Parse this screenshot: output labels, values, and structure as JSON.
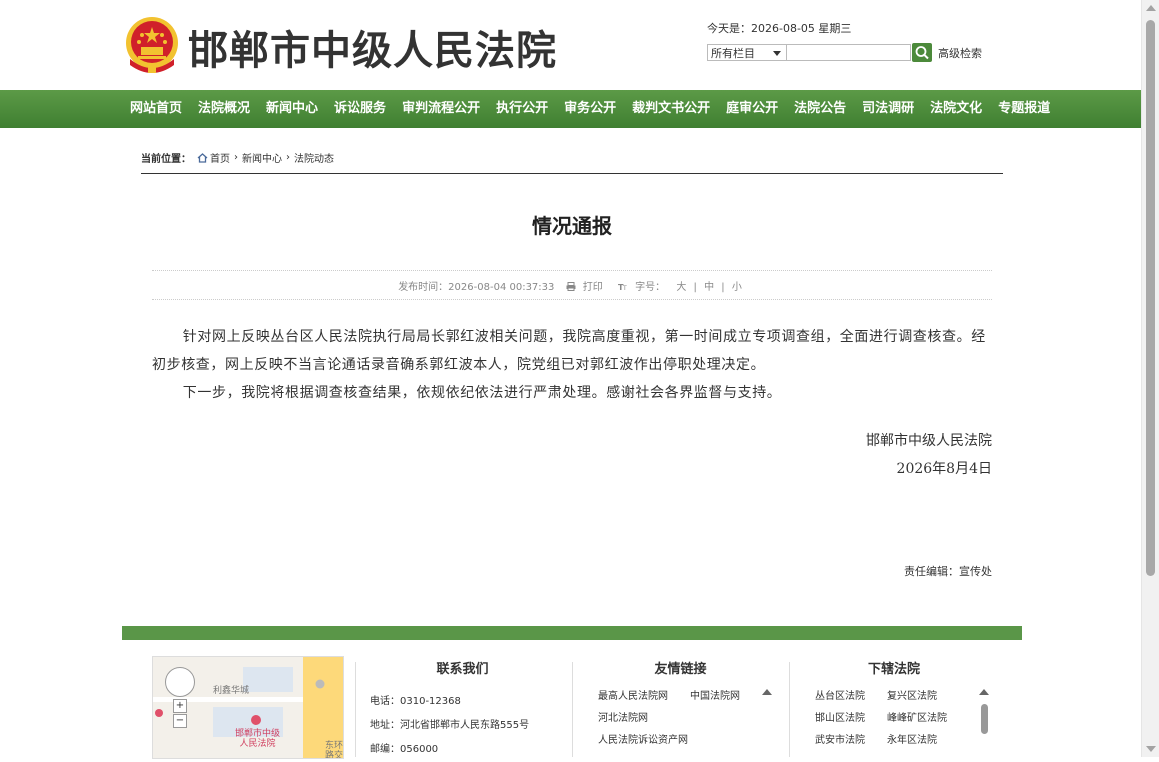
{
  "header": {
    "site_title": "邯郸市中级人民法院",
    "today": "今天是：2026-08-05 星期三",
    "search_scope": "所有栏目",
    "search_placeholder": "",
    "advanced_search": "高级检索"
  },
  "nav": {
    "items": [
      "网站首页",
      "法院概况",
      "新闻中心",
      "诉讼服务",
      "审判流程公开",
      "执行公开",
      "审务公开",
      "裁判文书公开",
      "庭审公开",
      "法院公告",
      "司法调研",
      "法院文化",
      "专题报道"
    ]
  },
  "breadcrumb": {
    "label": "当前位置：",
    "items": [
      "首页",
      "新闻中心",
      "法院动态"
    ],
    "separator": "›"
  },
  "article": {
    "title": "情况通报",
    "publish_time": "发布时间：2026-08-04 00:37:33",
    "print": "打印",
    "font_size_label": "字号：",
    "font_large": "大",
    "font_medium": "中",
    "font_small": "小",
    "paragraph1": "针对网上反映丛台区人民法院执行局局长郭红波相关问题，我院高度重视，第一时间成立专项调查组，全面进行调查核查。经初步核查，网上反映不当言论通话录音确系郭红波本人，院党组已对郭红波作出停职处理决定。",
    "paragraph2": "下一步，我院将根据调查核查结果，依规依纪依法进行严肃处理。感谢社会各界监督与支持。",
    "signature_org": "邯郸市中级人民法院",
    "signature_date": "2026年8月4日",
    "editor": "责任编辑：宣传处"
  },
  "footer": {
    "map": {
      "area_label": "利鑫华城",
      "place_label_1": "邯郸市中级",
      "place_label_2": "人民法院",
      "edge_label_1": "东环",
      "edge_label_2": "路交"
    },
    "contact": {
      "title": "联系我们",
      "phone": "电话：0310-12368",
      "address": "地址：河北省邯郸市人民东路555号",
      "postcode": "邮编：056000"
    },
    "friend_links": {
      "title": "友情链接",
      "row1a": "最高人民法院网",
      "row1b": "中国法院网",
      "row2a": "河北法院网",
      "row3a": "人民法院诉讼资产网"
    },
    "courts": {
      "title": "下辖法院",
      "row1a": "丛台区法院",
      "row1b": "复兴区法院",
      "row2a": "邯山区法院",
      "row2b": "峰峰矿区法院",
      "row3a": "武安市法院",
      "row3b": "永年区法院"
    }
  },
  "colors": {
    "nav_green": "#4c8a3b",
    "footer_green": "#5a9648",
    "emblem_red": "#d0202a",
    "emblem_gold": "#f2c230"
  }
}
